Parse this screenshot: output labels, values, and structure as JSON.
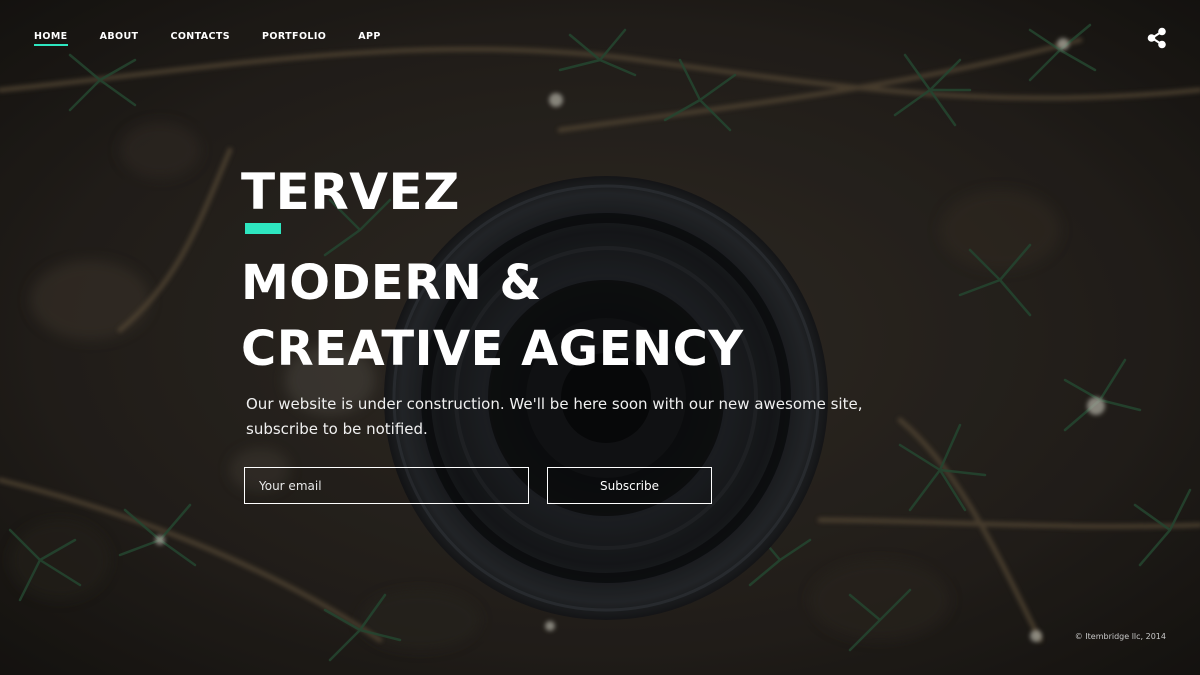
{
  "colors": {
    "accent": "#2ee6c0",
    "text": "#ffffff",
    "background": "#2a2620"
  },
  "nav": {
    "items": [
      {
        "label": "HOME",
        "active": true
      },
      {
        "label": "ABOUT",
        "active": false
      },
      {
        "label": "CONTACTS",
        "active": false
      },
      {
        "label": "PORTFOLIO",
        "active": false
      },
      {
        "label": "APP",
        "active": false
      }
    ],
    "share_icon": "share-icon"
  },
  "hero": {
    "brand": "TERVEZ",
    "headline_line1": "MODERN &",
    "headline_line2": "CREATIVE AGENCY",
    "subtext_line1": "Our website is under construction. We'll be here soon with our new awesome site,",
    "subtext_line2": "subscribe to be notified."
  },
  "form": {
    "email_placeholder": "Your email",
    "subscribe_label": "Subscribe"
  },
  "footer": {
    "copyright": "© Itembridge llc, 2014"
  }
}
